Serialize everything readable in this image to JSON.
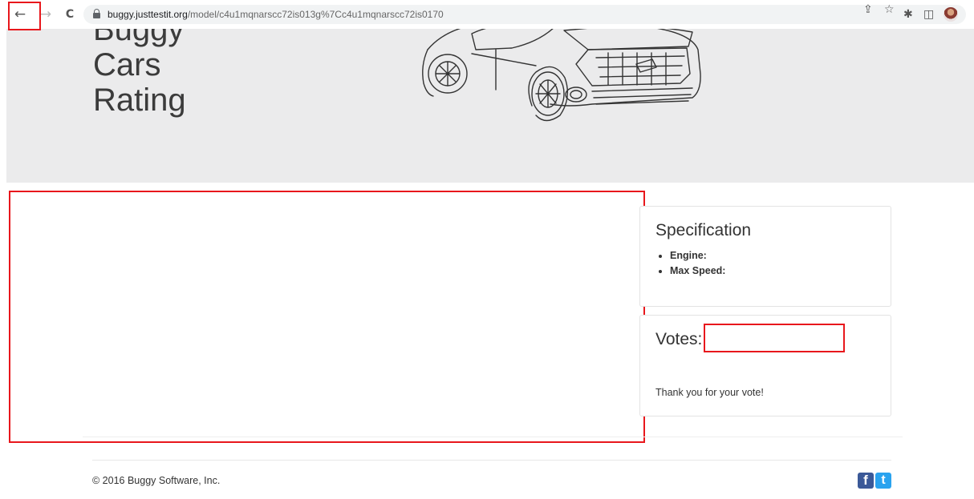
{
  "browser": {
    "back_icon": "←",
    "forward_icon": "→",
    "reload_icon": "C",
    "url_host": "buggy.justtestit.org",
    "url_path": "/model/c4u1mqnarscc72is013g%7Cc4u1mqnarscc72is0170",
    "share_icon": "⇪",
    "star_icon": "☆",
    "extensions_icon": "✱",
    "sidepanel_icon": "◫"
  },
  "header": {
    "brand_line1": "Buggy",
    "brand_line2": "Cars",
    "brand_line3": "Rating"
  },
  "specification": {
    "title": "Specification",
    "engine_label": "Engine:",
    "max_speed_label": "Max Speed:"
  },
  "votes": {
    "label": "Votes:",
    "message": "Thank you for your vote!"
  },
  "footer": {
    "copyright": "© 2016 Buggy Software, Inc.",
    "facebook": "f",
    "twitter": "t"
  },
  "colors": {
    "highlight": "#e8171c",
    "header_bg": "#ebebec",
    "facebook": "#3b5998",
    "twitter": "#2aa3ef"
  }
}
